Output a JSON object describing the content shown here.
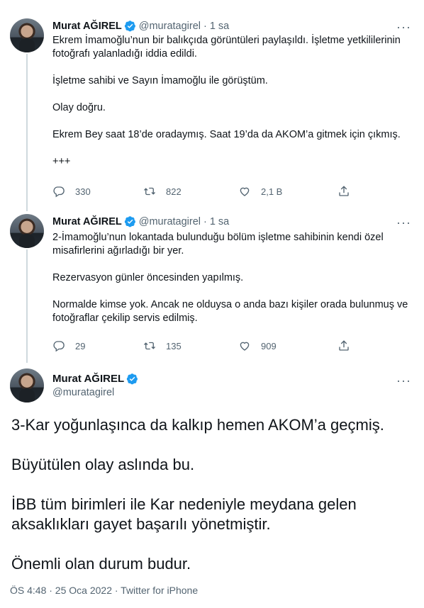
{
  "tweets": [
    {
      "name": "Murat AĞIREL",
      "handle": "@muratagirel",
      "sep": "·",
      "time": "1 sa",
      "paragraphs": [
        "Ekrem İmamoğlu’nun bir balıkçıda görüntüleri paylaşıldı. İşletme yetkililerinin fotoğrafı yalanladığı iddia edildi.",
        "İşletme sahibi ve Sayın İmamoğlu ile görüştüm.",
        "Olay doğru.",
        "Ekrem Bey saat 18’de oradaymış. Saat 19’da da AKOM’a gitmek için çıkmış.",
        "+++"
      ],
      "replies": "330",
      "retweets": "822",
      "likes": "2,1 B"
    },
    {
      "name": "Murat AĞIREL",
      "handle": "@muratagirel",
      "sep": "·",
      "time": "1 sa",
      "paragraphs": [
        "2-İmamoğlu’nun lokantada bulunduğu bölüm işletme sahibinin kendi özel misafirlerini ağırladığı bir yer.",
        "Rezervasyon günler öncesinden yapılmış.",
        "Normalde kimse yok. Ancak ne olduysa o anda bazı kişiler orada bulunmuş ve fotoğraflar çekilip servis edilmiş."
      ],
      "replies": "29",
      "retweets": "135",
      "likes": "909"
    }
  ],
  "main_tweet": {
    "name": "Murat AĞIREL",
    "handle": "@muratagirel",
    "paragraphs": [
      "3-Kar yoğunlaşınca da kalkıp hemen AKOM’a geçmiş.",
      "Büyütülen olay aslında bu.",
      "İBB tüm birimleri ile Kar nedeniyle meydana gelen aksaklıkları gayet başarılı yönetmiştir.",
      "Önemli olan durum budur."
    ],
    "meta": "ÖS 4:48 · 25 Oca 2022 · Twitter for iPhone"
  },
  "more_label": "···",
  "icons": {
    "verified": "verified-badge-icon",
    "reply": "reply-icon",
    "retweet": "retweet-icon",
    "like": "heart-icon",
    "share": "share-icon",
    "more": "more-icon"
  },
  "colors": {
    "verified": "#1d9bf0",
    "secondary_text": "#536471",
    "primary_text": "#0f1419",
    "thread_line": "#cfd9de"
  }
}
